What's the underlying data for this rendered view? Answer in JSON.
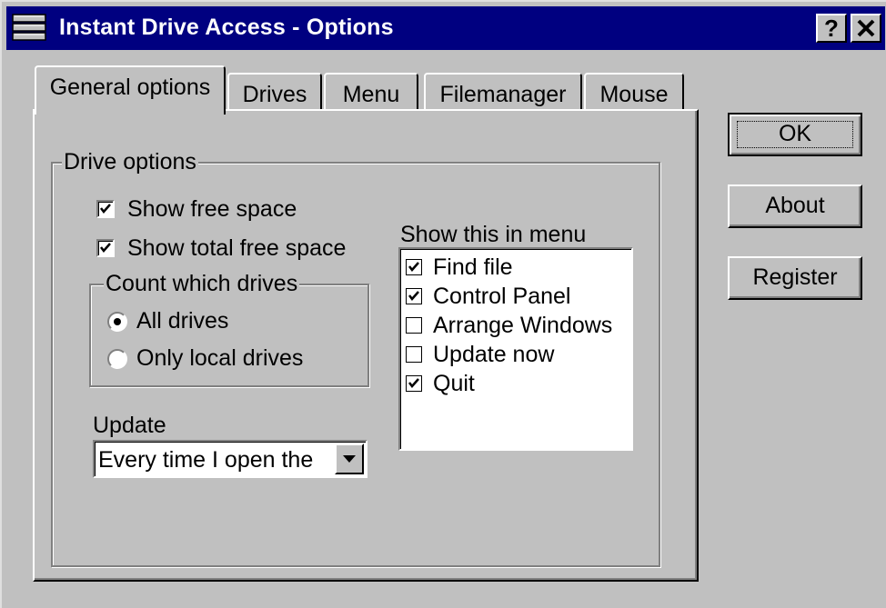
{
  "window": {
    "title": "Instant Drive Access - Options",
    "help_label": "?",
    "close_label": "✕"
  },
  "tabs": [
    {
      "label": "General options",
      "active": true
    },
    {
      "label": "Drives",
      "active": false
    },
    {
      "label": "Menu",
      "active": false
    },
    {
      "label": "Filemanager",
      "active": false
    },
    {
      "label": "Mouse",
      "active": false
    }
  ],
  "drive_options": {
    "legend": "Drive options",
    "show_free_space": {
      "label": "Show free space",
      "checked": true
    },
    "show_total_free_space": {
      "label": "Show total free space",
      "checked": true
    },
    "count_which_drives": {
      "legend": "Count which drives",
      "options": [
        {
          "label": "All drives",
          "selected": true
        },
        {
          "label": "Only local drives",
          "selected": false
        }
      ]
    },
    "update": {
      "label": "Update",
      "selected_value": "Every time I open the"
    }
  },
  "menu_list": {
    "label": "Show this in menu",
    "items": [
      {
        "label": "Find file",
        "checked": true
      },
      {
        "label": "Control Panel",
        "checked": true
      },
      {
        "label": "Arrange Windows",
        "checked": false
      },
      {
        "label": "Update now",
        "checked": false
      },
      {
        "label": "Quit",
        "checked": true
      }
    ]
  },
  "buttons": {
    "ok": "OK",
    "about": "About",
    "register": "Register"
  },
  "icons": {
    "app": "drive-stack-icon",
    "combo_arrow": "chevron-down-icon"
  }
}
